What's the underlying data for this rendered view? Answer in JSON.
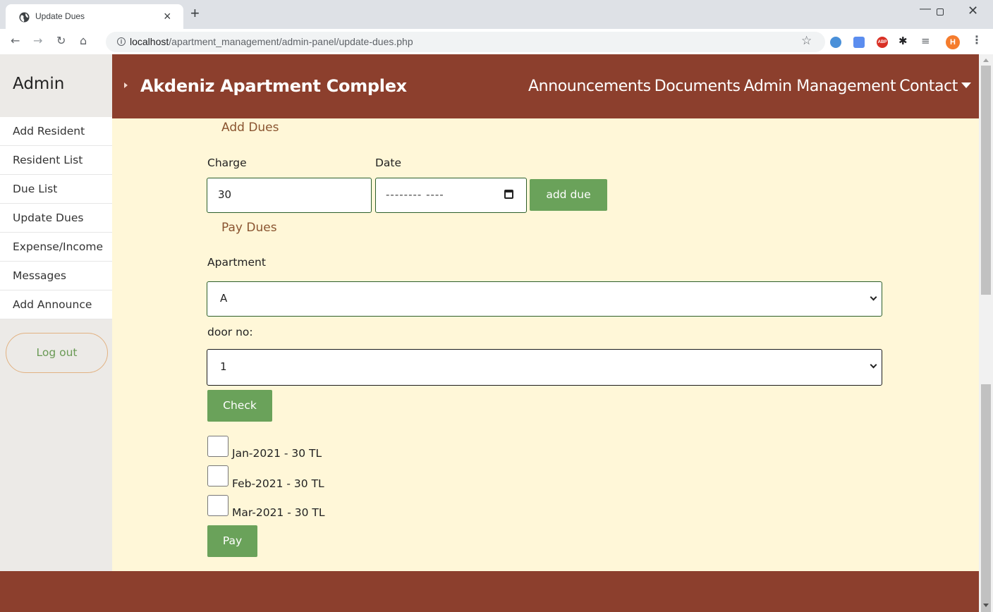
{
  "browser": {
    "tab_title": "Update Dues",
    "tab_close": "×",
    "new_tab": "+",
    "url_host": "localhost",
    "url_path": "/apartment_management/admin-panel/update-dues.php",
    "profile_initial": "H"
  },
  "sidebar": {
    "title": "Admin",
    "items": [
      {
        "label": "Add Resident"
      },
      {
        "label": "Resident List"
      },
      {
        "label": "Due List"
      },
      {
        "label": "Update Dues"
      },
      {
        "label": "Expense/Income"
      },
      {
        "label": "Messages"
      },
      {
        "label": "Add Announce"
      }
    ],
    "logout_label": "Log out"
  },
  "header": {
    "brand": "Akdeniz Apartment Complex",
    "nav": [
      "Announcements",
      "Documents",
      "Admin Management",
      "Contact"
    ]
  },
  "add_dues": {
    "heading": "Add Dues",
    "charge_label": "Charge",
    "charge_value": "30",
    "date_label": "Date",
    "date_value": "-------- ----",
    "button_label": "add due"
  },
  "pay_dues": {
    "heading": "Pay Dues",
    "apartment_label": "Apartment",
    "apartment_value": "A",
    "door_label": "door no:",
    "door_value": "1",
    "check_label": "Check",
    "dues": [
      {
        "label": "Jan-2021 - 30 TL",
        "checked": false
      },
      {
        "label": "Feb-2021 - 30 TL",
        "checked": false
      },
      {
        "label": "Mar-2021 - 30 TL",
        "checked": false
      }
    ],
    "pay_label": "Pay"
  },
  "colors": {
    "header_bg": "#8c3f2d",
    "main_bg": "#fff7d8",
    "button_green": "#6aa25a",
    "sidebar_bg": "#eceae7"
  }
}
